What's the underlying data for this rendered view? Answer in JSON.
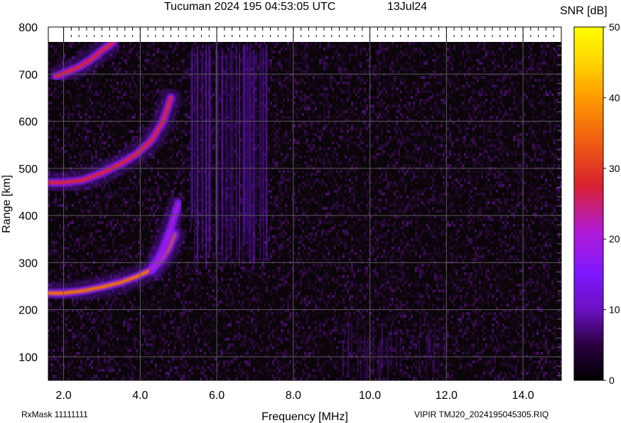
{
  "header": {
    "title": "Tucuman 2024 195 04:53:05 UTC",
    "date": "13Jul24"
  },
  "footer": {
    "rxmask": "RxMask 11111111",
    "file": "VIPIR  TMJ20_2024195045305.RIQ"
  },
  "chart_data": {
    "type": "heatmap",
    "title": "Tucuman 2024 195 04:53:05 UTC",
    "xlabel": "Frequency [MHz]",
    "ylabel": "Range [km]",
    "xlim": [
      1.6,
      15.0
    ],
    "ylim": [
      50,
      800
    ],
    "x_ticks": [
      2.0,
      4.0,
      6.0,
      8.0,
      10.0,
      12.0,
      14.0
    ],
    "x_tick_labels": [
      "2.0",
      "4.0",
      "6.0",
      "8.0",
      "10.0",
      "12.0",
      "14.0"
    ],
    "y_ticks": [
      100,
      200,
      300,
      400,
      500,
      600,
      700,
      800
    ],
    "y_tick_labels": [
      "100",
      "200",
      "300",
      "400",
      "500",
      "600",
      "700",
      "800"
    ],
    "grid": true,
    "colorbar": {
      "label": "SNR [dB]",
      "range": [
        0,
        50
      ],
      "ticks": [
        0,
        10,
        20,
        30,
        40,
        50
      ],
      "tick_labels": [
        "0",
        "10",
        "20",
        "30",
        "40",
        "50"
      ],
      "colors": [
        "#000000",
        "#2a0040",
        "#6a10c0",
        "#7d18ff",
        "#b01ad8",
        "#d82030",
        "#f06010",
        "#ff9a00",
        "#ffd400",
        "#ffff00"
      ]
    },
    "traces": [
      {
        "name": "F1 trace",
        "x": [
          1.6,
          2.0,
          2.5,
          3.0,
          3.5,
          3.9,
          4.3,
          4.55,
          4.75,
          4.9
        ],
        "y": [
          235,
          235,
          240,
          248,
          258,
          270,
          285,
          305,
          330,
          360
        ],
        "peak_snr": 32
      },
      {
        "name": "F1 second branch",
        "x": [
          4.3,
          4.55,
          4.75,
          4.9,
          5.0
        ],
        "y": [
          285,
          320,
          360,
          400,
          425
        ],
        "peak_snr": 15
      },
      {
        "name": "2F trace",
        "x": [
          1.6,
          2.0,
          2.5,
          3.0,
          3.5,
          3.9,
          4.3,
          4.6,
          4.8
        ],
        "y": [
          470,
          470,
          475,
          490,
          510,
          530,
          560,
          600,
          650
        ],
        "peak_snr": 28
      },
      {
        "name": "3F trace",
        "x": [
          1.8,
          2.1,
          2.4,
          2.7,
          3.0,
          3.3
        ],
        "y": [
          695,
          705,
          715,
          730,
          750,
          768
        ],
        "peak_snr": 25
      }
    ]
  }
}
